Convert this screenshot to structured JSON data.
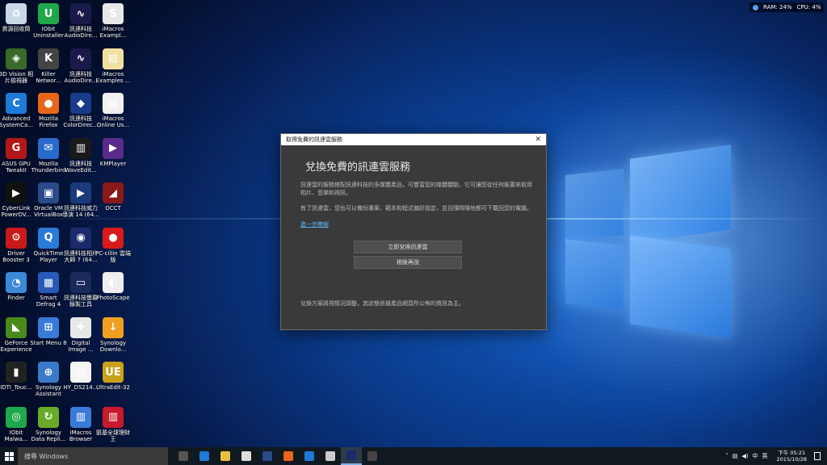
{
  "system_monitor": {
    "ram": "RAM: 24%",
    "cpu": "CPU: 4%"
  },
  "desktop_icons": [
    {
      "label": "資源回收筒",
      "color": "#c8d8e8",
      "glyph": "♻"
    },
    {
      "label": "IObit\nUninstaller",
      "color": "#1fa84a",
      "glyph": "U"
    },
    {
      "label": "訊連科技\nAudioDire...",
      "color": "#1a1a4a",
      "glyph": "∿"
    },
    {
      "label": "iMacros\nExampl...",
      "color": "#e8e8e8",
      "glyph": "S"
    },
    {
      "label": "3D Vision 相\n片檢視器",
      "color": "#3a6a2a",
      "glyph": "◈"
    },
    {
      "label": "Killer\nNetwor...",
      "color": "#444",
      "glyph": "K"
    },
    {
      "label": "訊連科技\nAudioDire...",
      "color": "#1a1a4a",
      "glyph": "∿"
    },
    {
      "label": "iMacros\nExamples ...",
      "color": "#f0e0a0",
      "glyph": "▤"
    },
    {
      "label": "Advanced\nSystemCa...",
      "color": "#1e7ad8",
      "glyph": "C"
    },
    {
      "label": "Mozilla\nFirefox",
      "color": "#e8651a",
      "glyph": "●"
    },
    {
      "label": "訊連科技\nColorDirec...",
      "color": "#1a3a8a",
      "glyph": "◆"
    },
    {
      "label": "iMacros\nOnline Us...",
      "color": "#f0f0f0",
      "glyph": "▤"
    },
    {
      "label": "ASUS GPU\nTweakII",
      "color": "#b01818",
      "glyph": "G"
    },
    {
      "label": "Mozilla\nThunderbird",
      "color": "#2a6ac8",
      "glyph": "✉"
    },
    {
      "label": "訊連科技\nWaveEdit...",
      "color": "#1a1a1a",
      "glyph": "▥"
    },
    {
      "label": "KMPlayer",
      "color": "#5a2a8a",
      "glyph": "▶"
    },
    {
      "label": "CyberLink\nPowerDV...",
      "color": "#111",
      "glyph": "▶"
    },
    {
      "label": "Oracle VM\nVirtualBox",
      "color": "#2a4a8a",
      "glyph": "▣"
    },
    {
      "label": "訊連科技威力\n導演 14 (64...",
      "color": "#1a3a7a",
      "glyph": "▶"
    },
    {
      "label": "OCCT",
      "color": "#8a1a1a",
      "glyph": "◢"
    },
    {
      "label": "Driver\nBooster 3",
      "color": "#c81a1a",
      "glyph": "⚙"
    },
    {
      "label": "QuickTime\nPlayer",
      "color": "#2a7ad8",
      "glyph": "Q"
    },
    {
      "label": "訊連科技相片\n大師 7 (64...",
      "color": "#1a2a6a",
      "glyph": "◉"
    },
    {
      "label": "PC-cillin 雲端\n版",
      "color": "#d81a1a",
      "glyph": "●"
    },
    {
      "label": "Finder",
      "color": "#3a8ad8",
      "glyph": "◔"
    },
    {
      "label": "Smart\nDefrag 4",
      "color": "#2a5ab8",
      "glyph": "▦"
    },
    {
      "label": "訊連科技螢幕\n錄製工具",
      "color": "#1a2a5a",
      "glyph": "▭"
    },
    {
      "label": "PhotoScape",
      "color": "#eeeeee",
      "glyph": "◐"
    },
    {
      "label": "GeForce\nExperience",
      "color": "#4a8a1a",
      "glyph": "◣"
    },
    {
      "label": "Start Menu 8",
      "color": "#3a7ad8",
      "glyph": "⊞"
    },
    {
      "label": "Digital\nImage ...",
      "color": "#e8e8e8",
      "glyph": "✚"
    },
    {
      "label": "Synology\nDownlo...",
      "color": "#f0a020",
      "glyph": "↓"
    },
    {
      "label": "IDTI_Touc...",
      "color": "#222",
      "glyph": "▮"
    },
    {
      "label": "Synology\nAssistant",
      "color": "#3a7ac8",
      "glyph": "⊕"
    },
    {
      "label": "HY_DS214...",
      "color": "#f5f5f5",
      "glyph": "▤"
    },
    {
      "label": "UltraEdit-32",
      "color": "#c8a01a",
      "glyph": "UE"
    },
    {
      "label": "IObit\nMalwa...",
      "color": "#1fa84a",
      "glyph": "◎"
    },
    {
      "label": "Synology\nData Repli...",
      "color": "#6aaa2a",
      "glyph": "↻"
    },
    {
      "label": "iMacros\nBrowser",
      "color": "#3a7ad8",
      "glyph": "▥"
    },
    {
      "label": "凱基全球理財\n王",
      "color": "#c81a2a",
      "glyph": "▥"
    }
  ],
  "dialog": {
    "title": "取得免費的訊連雲服務",
    "close_glyph": "✕",
    "heading": "兌換免費的訊連雲服務",
    "paragraph1": "訊連雲的服務搭配訊連科技的多媒體產品，可豐富您的媒體體驗，它可讓您從任何裝置來取用相片、音樂和視訊。",
    "paragraph2": "有了訊連雲，您也可以備份專案、範本和程式偏好設定，並且隨時隨地都可下載回您的電腦。",
    "link": "進一步瞭解",
    "redeem_button": "立即兌換訊連雲",
    "later_button": "稍後再說",
    "footer": "兌換方案將視情況調整，其狀態依據產品網頁所公佈的資訊為主。"
  },
  "taskbar": {
    "search_placeholder": "搜尋 Windows",
    "apps": [
      {
        "name": "task-view",
        "color": "#555"
      },
      {
        "name": "edge",
        "color": "#1e7ad8"
      },
      {
        "name": "file-explorer",
        "color": "#e8c040"
      },
      {
        "name": "store",
        "color": "#dddddd"
      },
      {
        "name": "virtualbox",
        "color": "#2a4a8a"
      },
      {
        "name": "firefox",
        "color": "#e8651a"
      },
      {
        "name": "advanced-systemcare",
        "color": "#1e7ad8"
      },
      {
        "name": "network-drive",
        "color": "#cccccc"
      },
      {
        "name": "photo-director",
        "color": "#1a2a6a"
      },
      {
        "name": "cyberlink-app",
        "color": "#444"
      }
    ],
    "tray": {
      "lang": "英",
      "ime": "中",
      "time": "下午 05:21",
      "date": "2015/10/28"
    }
  }
}
